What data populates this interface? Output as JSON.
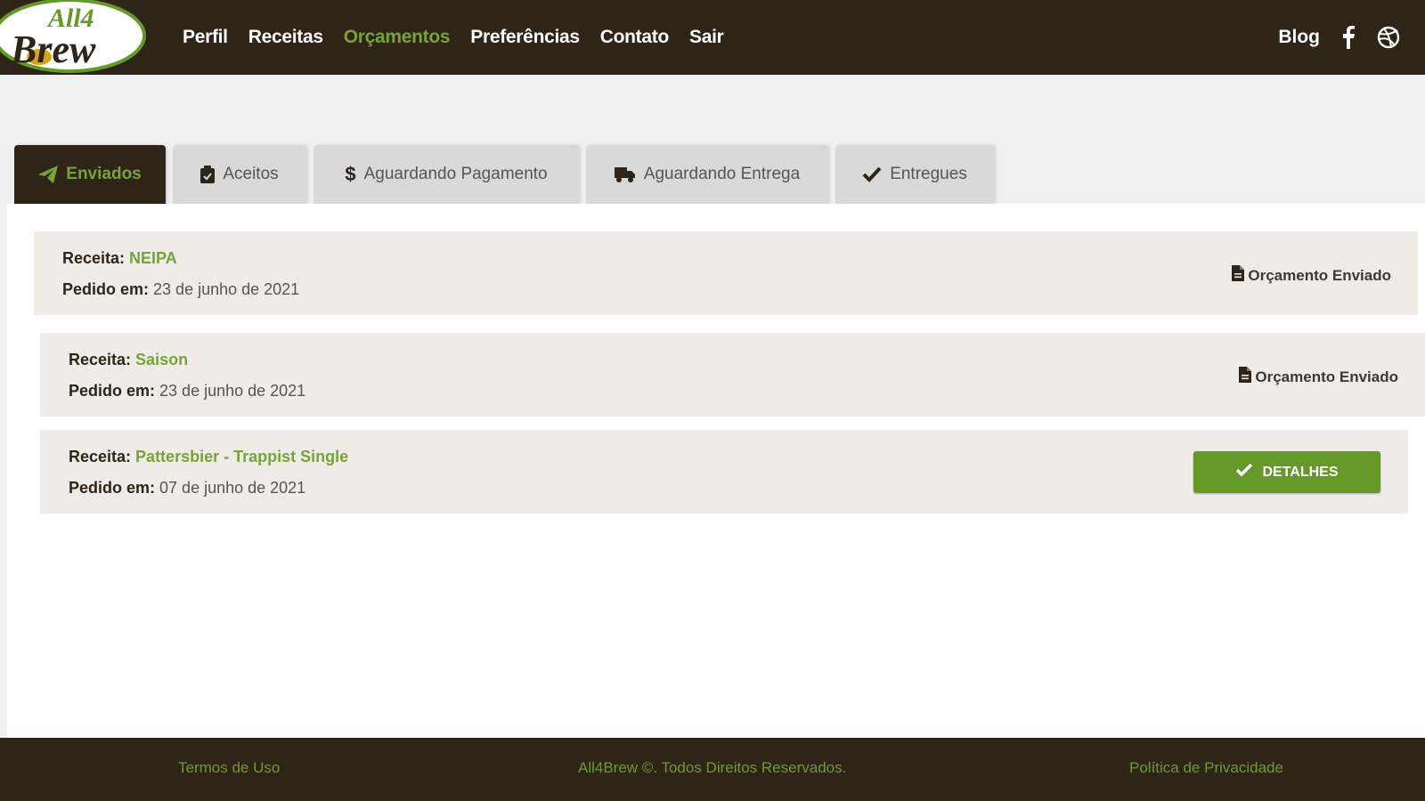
{
  "header": {
    "logo_text_top": "All4",
    "logo_text_bottom": "Brew",
    "nav": [
      {
        "label": "Perfil"
      },
      {
        "label": "Receitas"
      },
      {
        "label": "Orçamentos",
        "active": true
      },
      {
        "label": "Preferências"
      },
      {
        "label": "Contato"
      },
      {
        "label": "Sair"
      }
    ],
    "blog_label": "Blog",
    "social_icons": [
      "facebook-icon",
      "dribbble-icon"
    ]
  },
  "tabs": [
    {
      "label": "Enviados",
      "icon": "paper-plane-icon",
      "active": true
    },
    {
      "label": "Aceitos",
      "icon": "clipboard-check-icon"
    },
    {
      "label": "Aguardando Pagamento",
      "icon": "dollar-icon"
    },
    {
      "label": "Aguardando Entrega",
      "icon": "truck-icon"
    },
    {
      "label": "Entregues",
      "icon": "check-icon"
    }
  ],
  "orders": [
    {
      "recipe_label": "Receita:",
      "recipe": "NEIPA",
      "date_label": "Pedido em:",
      "date": "23 de junho de 2021",
      "status": "Orçamento Enviado"
    },
    {
      "recipe_label": "Receita:",
      "recipe": "Saison",
      "date_label": "Pedido em:",
      "date": "23 de junho de 2021",
      "status": "Orçamento Enviado"
    },
    {
      "recipe_label": "Receita:",
      "recipe": "Pattersbier - Trappist Single",
      "date_label": "Pedido em:",
      "date": "07 de junho de 2021",
      "button": "DETALHES"
    }
  ],
  "footer": {
    "terms": "Termos de Uso",
    "copyright": "All4Brew ©. Todos Direitos Reservados.",
    "privacy": "Política de Privacidade"
  },
  "colors": {
    "dark_brown": "#2f2418",
    "accent_green": "#77a33a",
    "button_green": "#659a2a",
    "card_bg": "#efece7"
  }
}
